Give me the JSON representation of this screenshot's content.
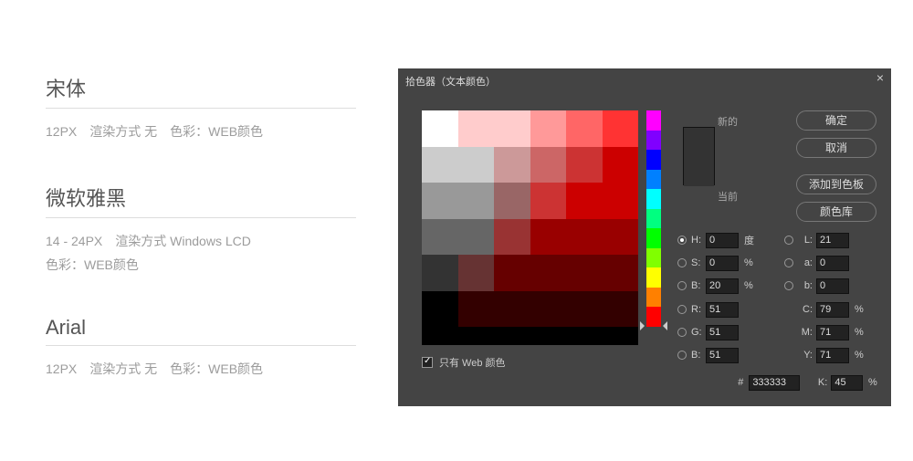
{
  "left": {
    "blocks": [
      {
        "title": "宋体",
        "desc": "12PX　渲染方式 无　色彩：WEB颜色"
      },
      {
        "title": "微软雅黑",
        "desc": "14 - 24PX　渲染方式 Windows LCD\n色彩：WEB颜色"
      },
      {
        "title": "Arial",
        "desc": "12PX　渲染方式 无　色彩：WEB颜色"
      }
    ]
  },
  "dialog": {
    "title": "拾色器（文本颜色）",
    "close": "×",
    "labels": {
      "new": "新的",
      "current": "当前"
    },
    "buttons": {
      "ok": "确定",
      "cancel": "取消",
      "addSwatch": "添加到色板",
      "lib": "颜色库"
    },
    "fields": {
      "H": {
        "label": "H:",
        "value": "0",
        "unit": "度"
      },
      "S": {
        "label": "S:",
        "value": "0",
        "unit": "%"
      },
      "B": {
        "label": "B:",
        "value": "20",
        "unit": "%"
      },
      "R": {
        "label": "R:",
        "value": "51"
      },
      "G": {
        "label": "G:",
        "value": "51"
      },
      "Bch": {
        "label": "B:",
        "value": "51"
      },
      "L": {
        "label": "L:",
        "value": "21"
      },
      "a": {
        "label": "a:",
        "value": "0"
      },
      "b": {
        "label": "b:",
        "value": "0"
      },
      "C": {
        "label": "C:",
        "value": "79",
        "unit": "%"
      },
      "M": {
        "label": "M:",
        "value": "71",
        "unit": "%"
      },
      "Y": {
        "label": "Y:",
        "value": "71",
        "unit": "%"
      },
      "K": {
        "label": "K:",
        "value": "45",
        "unit": "%"
      },
      "hex": {
        "label": "#",
        "value": "333333"
      }
    },
    "webOnly": {
      "label": "只有 Web 颜色",
      "checked": true
    },
    "colors": {
      "preview_new": "#333333",
      "preview_current": "#333333"
    },
    "swatches": [
      [
        "#ffffff",
        "#ffcccc",
        "#ffcccc",
        "#ff9999",
        "#ff6666",
        "#ff3333"
      ],
      [
        "#cccccc",
        "#cccccc",
        "#cc9999",
        "#cc6666",
        "#cc3333",
        "#cc0000"
      ],
      [
        "#999999",
        "#999999",
        "#996666",
        "#cc3333",
        "#cc0000",
        "#cc0000"
      ],
      [
        "#666666",
        "#666666",
        "#993333",
        "#990000",
        "#990000",
        "#990000"
      ],
      [
        "#333333",
        "#663333",
        "#660000",
        "#660000",
        "#660000",
        "#660000"
      ],
      [
        "#000000",
        "#330000",
        "#330000",
        "#330000",
        "#330000",
        "#330000"
      ]
    ],
    "hue": [
      "#ff00ff",
      "#8000ff",
      "#0000ff",
      "#0080ff",
      "#00ffff",
      "#00ff80",
      "#00ff00",
      "#80ff00",
      "#ffff00",
      "#ff8000",
      "#ff0000"
    ]
  }
}
